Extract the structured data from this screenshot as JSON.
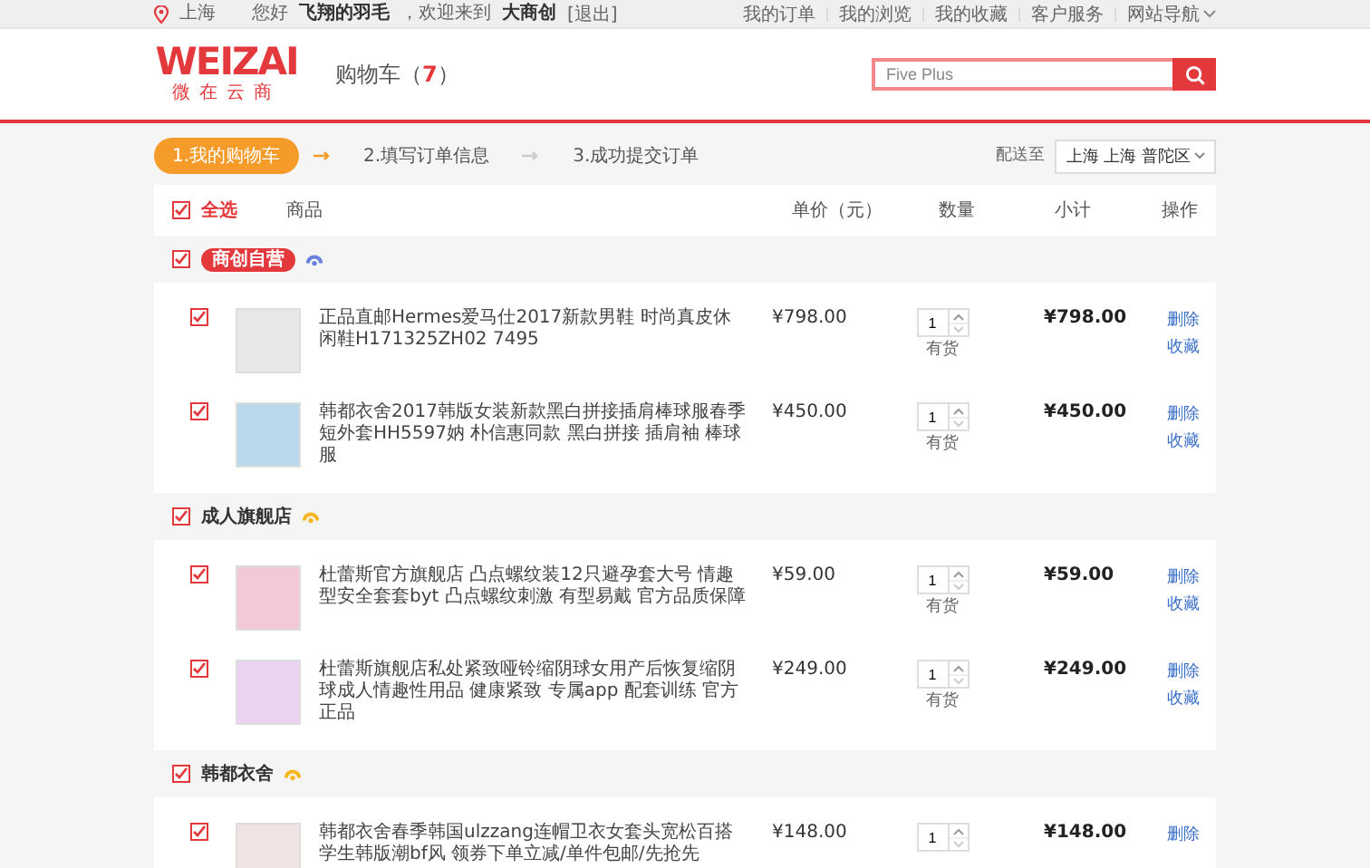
{
  "topbar": {
    "location": "上海",
    "greeting": "您好",
    "username": "飞翔的羽毛",
    "welcome": "，欢迎来到",
    "site": "大商创",
    "logout": "[退出]",
    "links": [
      {
        "label": "我的订单",
        "kind": "link"
      },
      {
        "label": "我的浏览",
        "kind": "link"
      },
      {
        "label": "我的收藏",
        "kind": "link"
      },
      {
        "label": "客户服务",
        "kind": "link"
      },
      {
        "label": "网站导航",
        "kind": "menu"
      }
    ]
  },
  "header": {
    "logo": "WEIZAI",
    "logo_sub": "微在云商",
    "cart_label": "购物车（",
    "cart_count": "7",
    "cart_close": "）",
    "search": {
      "placeholder": "Five Plus"
    }
  },
  "steps": [
    {
      "label": "1.我的购物车",
      "selected": true
    },
    {
      "label": "2.填写订单信息",
      "selected": false
    },
    {
      "label": "3.成功提交订单",
      "selected": false
    }
  ],
  "delivery": {
    "label": "配送至",
    "region": "上海 上海 普陀区"
  },
  "table": {
    "select_all": {
      "label": "全选",
      "checked": true
    },
    "columns": [
      "商品",
      "单价（元）",
      "数量",
      "小计",
      "操作"
    ]
  },
  "stores": [
    {
      "name": "商创自营",
      "kind": "badge",
      "checked": true,
      "items": [
        {
          "checked": true,
          "description": "正品直邮Hermes爱马仕2017新款男鞋 时尚真皮休闲鞋H171325ZH02 7495",
          "price": "¥798.00",
          "qty": "1",
          "stock": "有货",
          "subtotal": "¥798.00",
          "actions": [
            "删除",
            "收藏"
          ]
        },
        {
          "checked": true,
          "description": "韩都衣舍2017韩版女装新款黑白拼接插肩棒球服春季短外套HH5597妠 朴信惠同款 黑白拼接 插肩袖 棒球服",
          "price": "¥450.00",
          "qty": "1",
          "stock": "有货",
          "subtotal": "¥450.00",
          "actions": [
            "删除",
            "收藏"
          ]
        }
      ]
    },
    {
      "name": "成人旗舰店",
      "kind": "plain",
      "checked": true,
      "items": [
        {
          "checked": true,
          "description": "杜蕾斯官方旗舰店 凸点螺纹装12只避孕套大号 情趣型安全套套byt 凸点螺纹刺激 有型易戴 官方品质保障",
          "price": "¥59.00",
          "qty": "1",
          "stock": "有货",
          "subtotal": "¥59.00",
          "actions": [
            "删除",
            "收藏"
          ]
        },
        {
          "checked": true,
          "description": "杜蕾斯旗舰店私处紧致哑铃缩阴球女用产后恢复缩阴球成人情趣性用品 健康紧致 专属app 配套训练 官方正品",
          "price": "¥249.00",
          "qty": "1",
          "stock": "有货",
          "subtotal": "¥249.00",
          "actions": [
            "删除",
            "收藏"
          ]
        }
      ]
    },
    {
      "name": "韩都衣舍",
      "kind": "plain",
      "checked": true,
      "items": [
        {
          "checked": true,
          "description": "韩都衣舍春季韩国ulzzang连帽卫衣女套头宽松百搭学生韩版潮bf风 领券下单立减/单件包邮/先抢先",
          "price": "¥148.00",
          "qty": "1",
          "subtotal": "¥148.00",
          "actions": [
            "删除"
          ]
        }
      ]
    }
  ]
}
